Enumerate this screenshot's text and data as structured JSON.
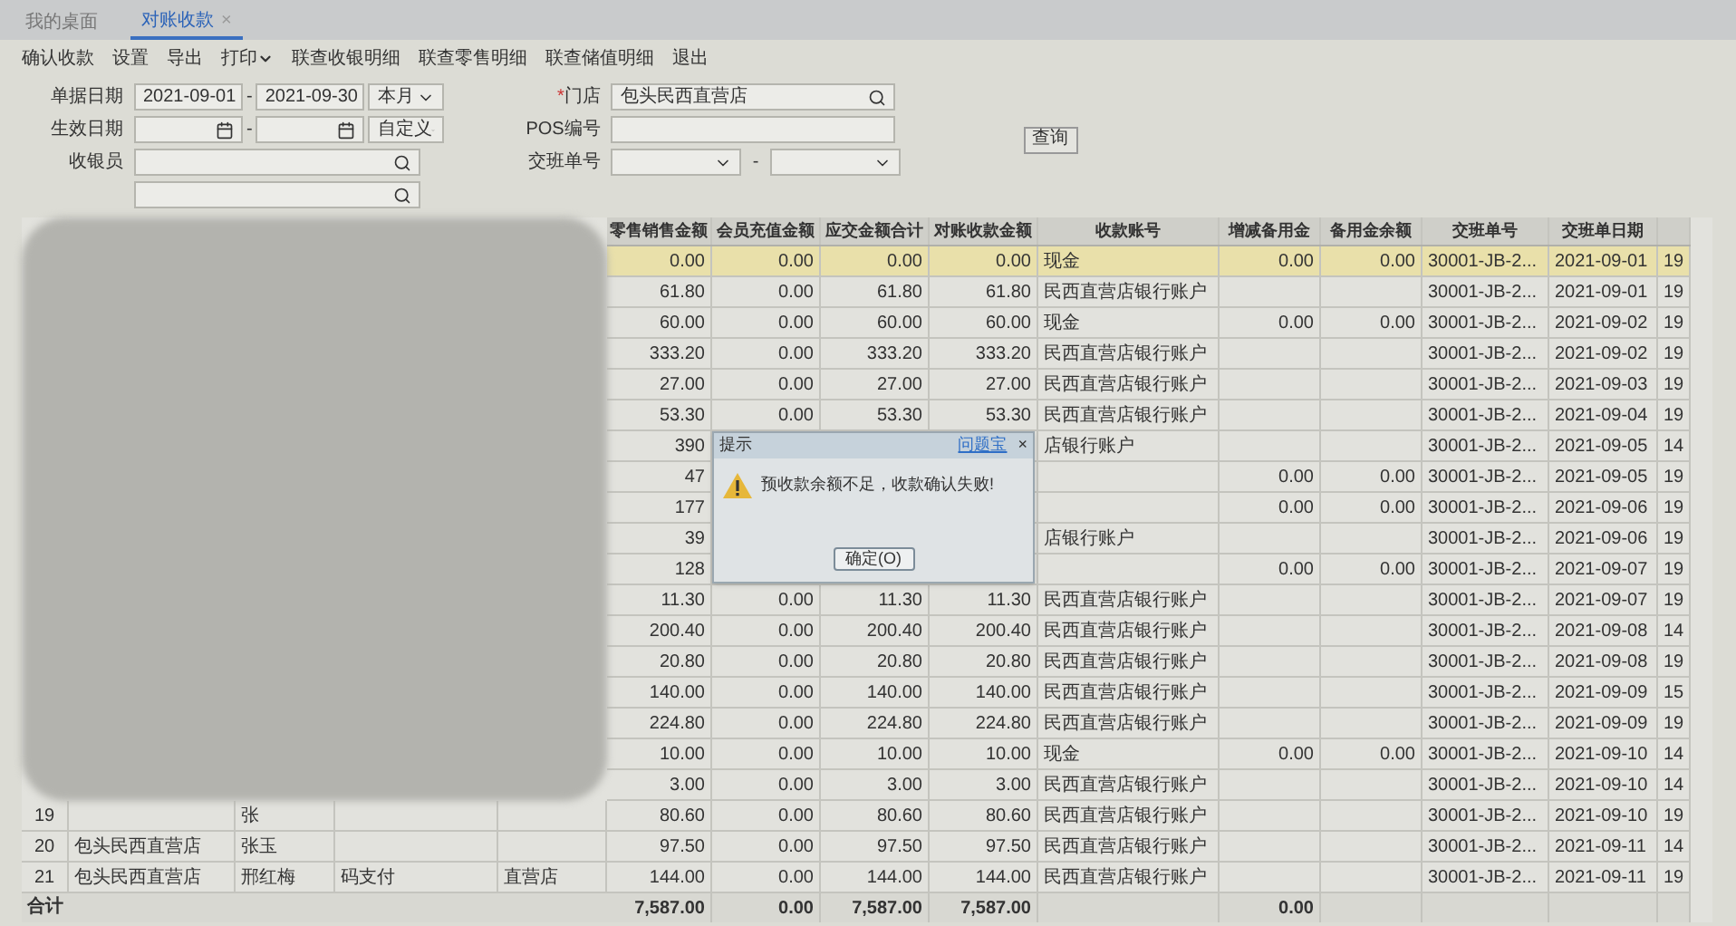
{
  "tabs": [
    {
      "label": "我的桌面",
      "selected": false
    },
    {
      "label": "对账收款",
      "selected": true,
      "close": "×"
    }
  ],
  "toolbar": [
    {
      "label": "确认收款",
      "dropdown": false
    },
    {
      "label": "设置",
      "dropdown": false
    },
    {
      "label": "导出",
      "dropdown": false
    },
    {
      "label": "打印",
      "dropdown": true
    },
    {
      "label": "联查收银明细",
      "dropdown": false
    },
    {
      "label": "联查零售明细",
      "dropdown": false
    },
    {
      "label": "联查储值明细",
      "dropdown": false
    },
    {
      "label": "退出",
      "dropdown": false
    }
  ],
  "filters": {
    "doc_date": {
      "label": "单据日期",
      "from": "2021-09-01",
      "to": "2021-09-30",
      "separator": "-",
      "range": "本月"
    },
    "effective_date": {
      "label": "生效日期",
      "separator": "-",
      "range": "自定义"
    },
    "cashier": {
      "label": "收银员"
    },
    "store": {
      "label": "门店",
      "required_mark": "*",
      "value": "包头民西直营店"
    },
    "pos": {
      "label": "POS编号"
    },
    "shift": {
      "label": "交班单号",
      "separator": "-"
    },
    "query_button": "查询"
  },
  "table": {
    "columns": [
      "零售销售金额",
      "会员充值金额",
      "应交金额合计",
      "对账收款金额",
      "收款账号",
      "增减备用金",
      "备用金余额",
      "交班单号",
      "交班单日期"
    ],
    "rows": [
      {
        "selected": true,
        "retail": "0.00",
        "member": "0.00",
        "due": "0.00",
        "reconciled": "0.00",
        "account": "现金",
        "petty_change": "0.00",
        "petty_balance": "0.00",
        "shift_no": "30001-JB-2...",
        "shift_date": "2021-09-01",
        "column_15": "19"
      },
      {
        "selected": false,
        "retail": "61.80",
        "member": "0.00",
        "due": "61.80",
        "reconciled": "61.80",
        "account": "民西直营店银行账户",
        "shift_no": "30001-JB-2...",
        "shift_date": "2021-09-01",
        "column_15": "19"
      },
      {
        "selected": false,
        "retail": "60.00",
        "member": "0.00",
        "due": "60.00",
        "reconciled": "60.00",
        "account": "现金",
        "petty_change": "0.00",
        "petty_balance": "0.00",
        "shift_no": "30001-JB-2...",
        "shift_date": "2021-09-02",
        "column_15": "19"
      },
      {
        "selected": false,
        "retail": "333.20",
        "member": "0.00",
        "due": "333.20",
        "reconciled": "333.20",
        "account": "民西直营店银行账户",
        "shift_no": "30001-JB-2...",
        "shift_date": "2021-09-02",
        "column_15": "19"
      },
      {
        "selected": false,
        "retail": "27.00",
        "member": "0.00",
        "due": "27.00",
        "reconciled": "27.00",
        "account": "民西直营店银行账户",
        "shift_no": "30001-JB-2...",
        "shift_date": "2021-09-03",
        "column_15": "19"
      },
      {
        "selected": false,
        "retail": "53.30",
        "member": "0.00",
        "due": "53.30",
        "reconciled": "53.30",
        "account": "民西直营店银行账户",
        "shift_no": "30001-JB-2...",
        "shift_date": "2021-09-04",
        "column_15": "19"
      },
      {
        "selected": false,
        "retail": "390",
        "account": "店银行账户",
        "shift_no": "30001-JB-2...",
        "shift_date": "2021-09-05",
        "column_15": "14"
      },
      {
        "selected": false,
        "retail": "47",
        "petty_change": "0.00",
        "petty_balance": "0.00",
        "shift_no": "30001-JB-2...",
        "shift_date": "2021-09-05",
        "column_15": "19"
      },
      {
        "selected": false,
        "retail": "177",
        "petty_change": "0.00",
        "petty_balance": "0.00",
        "shift_no": "30001-JB-2...",
        "shift_date": "2021-09-06",
        "column_15": "19"
      },
      {
        "selected": false,
        "retail": "39",
        "account": "店银行账户",
        "shift_no": "30001-JB-2...",
        "shift_date": "2021-09-06",
        "column_15": "19"
      },
      {
        "selected": false,
        "retail": "128",
        "petty_change": "0.00",
        "petty_balance": "0.00",
        "shift_no": "30001-JB-2...",
        "shift_date": "2021-09-07",
        "column_15": "19"
      },
      {
        "selected": false,
        "retail": "11.30",
        "member": "0.00",
        "due": "11.30",
        "reconciled": "11.30",
        "account": "民西直营店银行账户",
        "shift_no": "30001-JB-2...",
        "shift_date": "2021-09-07",
        "column_15": "19"
      },
      {
        "selected": false,
        "retail": "200.40",
        "member": "0.00",
        "due": "200.40",
        "reconciled": "200.40",
        "account": "民西直营店银行账户",
        "shift_no": "30001-JB-2...",
        "shift_date": "2021-09-08",
        "column_15": "14"
      },
      {
        "selected": false,
        "retail": "20.80",
        "member": "0.00",
        "due": "20.80",
        "reconciled": "20.80",
        "account": "民西直营店银行账户",
        "shift_no": "30001-JB-2...",
        "shift_date": "2021-09-08",
        "column_15": "19"
      },
      {
        "selected": false,
        "retail": "140.00",
        "member": "0.00",
        "due": "140.00",
        "reconciled": "140.00",
        "account": "民西直营店银行账户",
        "shift_no": "30001-JB-2...",
        "shift_date": "2021-09-09",
        "column_15": "15"
      },
      {
        "selected": false,
        "retail": "224.80",
        "member": "0.00",
        "due": "224.80",
        "reconciled": "224.80",
        "account": "民西直营店银行账户",
        "shift_no": "30001-JB-2...",
        "shift_date": "2021-09-09",
        "column_15": "19"
      },
      {
        "selected": false,
        "retail": "10.00",
        "member": "0.00",
        "due": "10.00",
        "reconciled": "10.00",
        "account": "现金",
        "petty_change": "0.00",
        "petty_balance": "0.00",
        "shift_no": "30001-JB-2...",
        "shift_date": "2021-09-10",
        "column_15": "14"
      },
      {
        "selected": false,
        "retail": "3.00",
        "member": "0.00",
        "due": "3.00",
        "reconciled": "3.00",
        "account": "民西直营店银行账户",
        "shift_no": "30001-JB-2...",
        "shift_date": "2021-09-10",
        "column_15": "14"
      },
      {
        "selected": false,
        "number": "19",
        "operator": "张",
        "retail": "80.60",
        "member": "0.00",
        "due": "80.60",
        "reconciled": "80.60",
        "account": "民西直营店银行账户",
        "shift_no": "30001-JB-2...",
        "shift_date": "2021-09-10",
        "column_15": "19"
      },
      {
        "selected": false,
        "number": "20",
        "store": "包头民西直营店",
        "operator": "张玉",
        "retail": "97.50",
        "member": "0.00",
        "due": "97.50",
        "reconciled": "97.50",
        "account": "民西直营店银行账户",
        "shift_no": "30001-JB-2...",
        "shift_date": "2021-09-11",
        "column_15": "14"
      },
      {
        "selected": false,
        "number": "21",
        "store": "包头民西直营店",
        "operator": "邢红梅",
        "payment": "码支付",
        "store_2": "直营店",
        "retail": "144.00",
        "member": "0.00",
        "due": "144.00",
        "reconciled": "144.00",
        "account": "民西直营店银行账户",
        "shift_no": "30001-JB-2...",
        "shift_date": "2021-09-11",
        "column_15": "19"
      }
    ],
    "totals": {
      "label": "合计",
      "retail": "7,587.00",
      "member": "0.00",
      "due": "7,587.00",
      "reconciled": "7,587.00",
      "petty_change": "0.00"
    }
  },
  "dialog": {
    "title": "提示",
    "link": "问题宝",
    "close": "×",
    "message": "预收款余额不足，收款确认失败!",
    "button": "确定(O)"
  }
}
